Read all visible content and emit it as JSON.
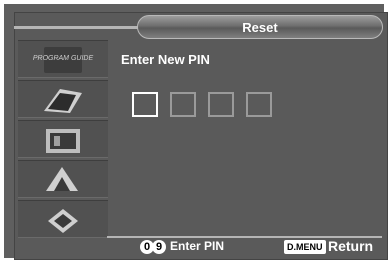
{
  "title": "Reset",
  "prompt": "Enter New PIN",
  "pin": {
    "digits": [
      "",
      "",
      "",
      ""
    ],
    "active_index": 0
  },
  "sidebar": {
    "items": [
      {
        "icon": "program-guide-icon",
        "label": "PROGRAM GUIDE"
      },
      {
        "icon": "picture-icon",
        "label": ""
      },
      {
        "icon": "sound-icon",
        "label": ""
      },
      {
        "icon": "channel-icon",
        "label": ""
      },
      {
        "icon": "setup-icon",
        "label": ""
      }
    ]
  },
  "footer": {
    "range_start": "0",
    "range_sep": "..",
    "range_end": "9",
    "enter_label": "Enter PIN",
    "menu_key": "D.MENU",
    "return_label": "Return"
  },
  "colors": {
    "frame": "#5f5f5f",
    "panel": "#5a5a5a",
    "text": "#ffffff",
    "pin_inactive": "#9a9a9a",
    "pin_active": "#ffffff"
  }
}
